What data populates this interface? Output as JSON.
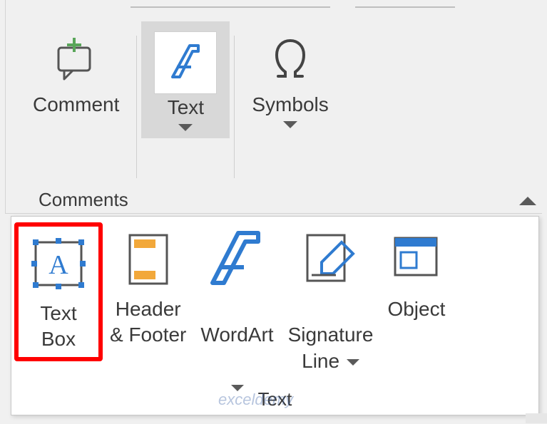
{
  "ribbon": {
    "group_label": "Comments",
    "buttons": {
      "comment": {
        "label": "Comment"
      },
      "text": {
        "label": "Text"
      },
      "symbols": {
        "label": "Symbols"
      }
    }
  },
  "popup": {
    "footer_label": "Text",
    "items": {
      "textbox": {
        "label": "Text\nBox"
      },
      "header_footer": {
        "label": "Header\n& Footer"
      },
      "wordart": {
        "label": "WordArt"
      },
      "signature": {
        "label": "Signature\nLine"
      },
      "object": {
        "label": "Object"
      }
    }
  },
  "watermark": "exceldemy",
  "colors": {
    "accent_blue": "#2f7bd0",
    "orange": "#f2a83a",
    "highlight": "#ff0000"
  }
}
